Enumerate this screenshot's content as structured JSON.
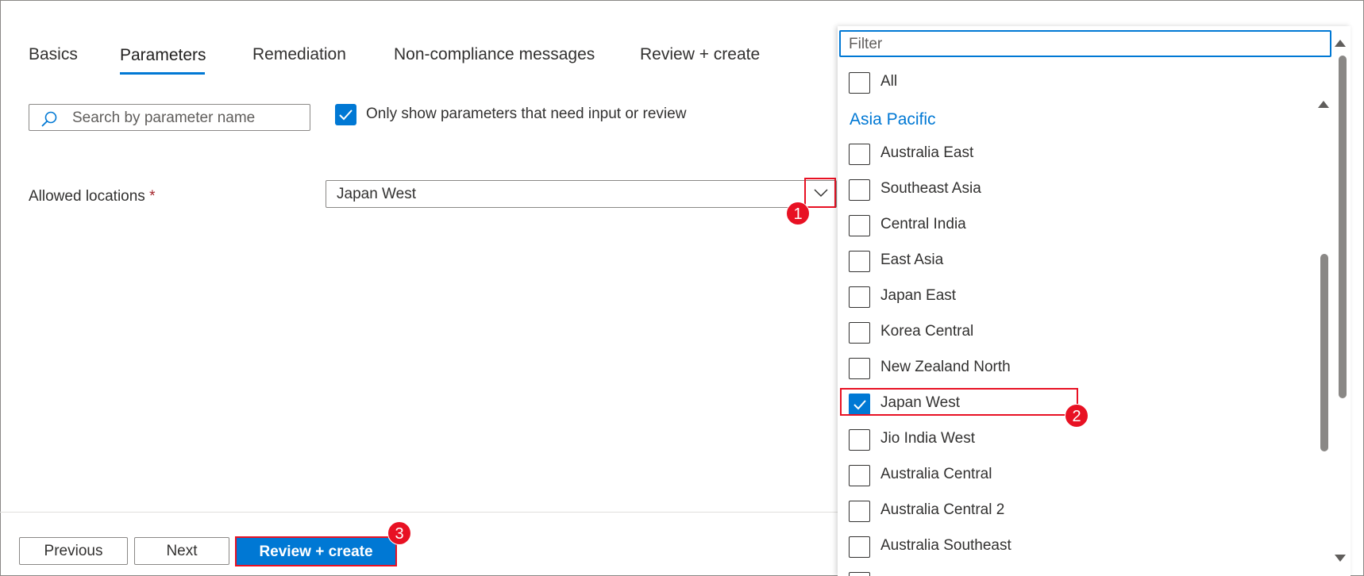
{
  "tabs": [
    {
      "label": "Basics",
      "active": false
    },
    {
      "label": "Parameters",
      "active": true
    },
    {
      "label": "Remediation",
      "active": false
    },
    {
      "label": "Non-compliance messages",
      "active": false
    },
    {
      "label": "Review + create",
      "active": false
    }
  ],
  "search": {
    "placeholder": "Search by parameter name",
    "icon": "search-icon"
  },
  "only_show": {
    "label": "Only show parameters that need input or review",
    "checked": true
  },
  "parameter": {
    "label": "Allowed locations",
    "required_mark": "*",
    "value": "Japan West"
  },
  "badges": {
    "one": "1",
    "two": "2",
    "three": "3"
  },
  "footer": {
    "previous": "Previous",
    "next": "Next",
    "review_create": "Review + create"
  },
  "dropdown": {
    "filter_placeholder": "Filter",
    "all_label": "All",
    "group": "Asia Pacific",
    "options": [
      {
        "label": "Australia East",
        "checked": false
      },
      {
        "label": "Southeast Asia",
        "checked": false
      },
      {
        "label": "Central India",
        "checked": false
      },
      {
        "label": "East Asia",
        "checked": false
      },
      {
        "label": "Japan East",
        "checked": false
      },
      {
        "label": "Korea Central",
        "checked": false
      },
      {
        "label": "New Zealand North",
        "checked": false
      },
      {
        "label": "Japan West",
        "checked": true
      },
      {
        "label": "Jio India West",
        "checked": false
      },
      {
        "label": "Australia Central",
        "checked": false
      },
      {
        "label": "Australia Central 2",
        "checked": false
      },
      {
        "label": "Australia Southeast",
        "checked": false
      }
    ]
  },
  "colors": {
    "accent": "#0078d4",
    "highlight": "#e81123"
  }
}
